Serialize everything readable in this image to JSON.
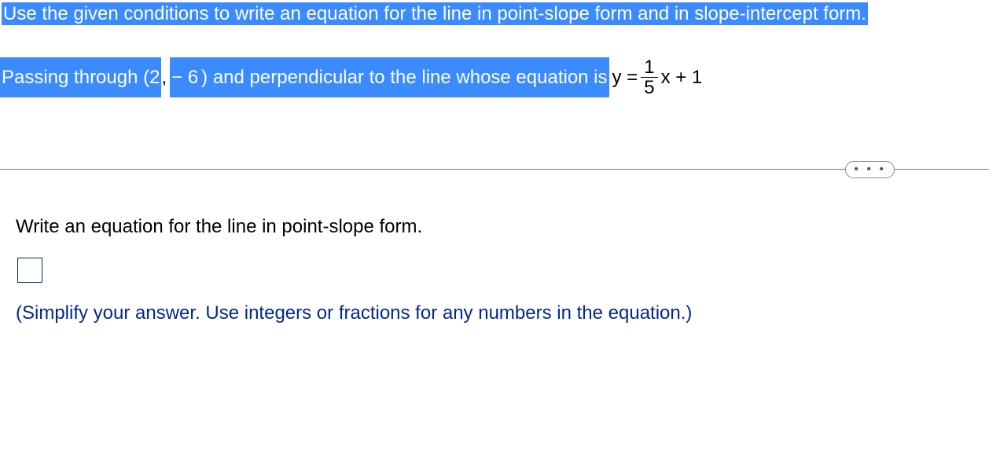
{
  "instruction": "Use the given conditions to write an equation for the line in point-slope form and in slope-intercept form.",
  "conditions": {
    "seg1": "Passing through (2",
    "comma": ",",
    "seg2": " − 6",
    "seg3": ") and perpendicular to the line whose equation is ",
    "eq_lhs": "y = ",
    "fraction_num": "1",
    "fraction_den": "5",
    "eq_rhs": "x + 1"
  },
  "more_button": "• • •",
  "prompt": "Write an equation for the line in point-slope form.",
  "hint": "(Simplify your answer. Use integers or fractions for any numbers in the equation.)",
  "chart_data": {
    "type": "table",
    "point": [
      2,
      -6
    ],
    "perpendicular_to_slope": "1/5",
    "perpendicular_to_intercept": 1,
    "forms_requested": [
      "point-slope",
      "slope-intercept"
    ]
  }
}
